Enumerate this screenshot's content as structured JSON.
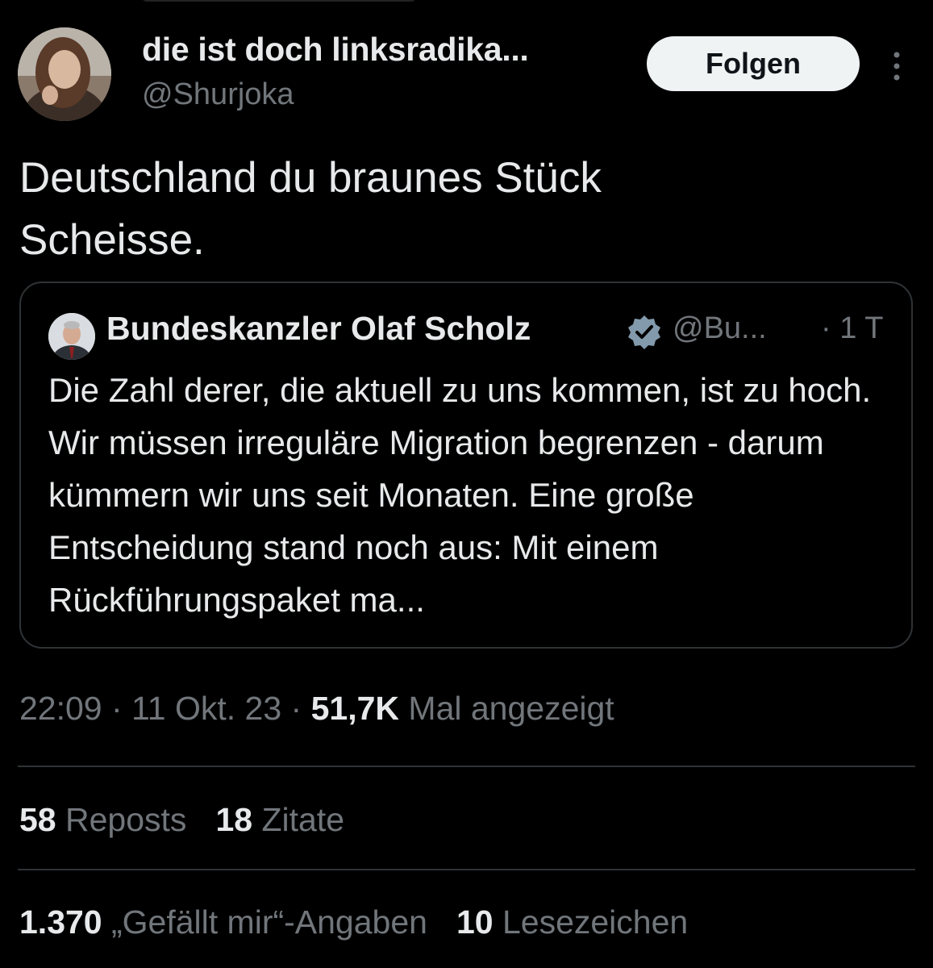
{
  "tweet": {
    "author": {
      "display_name": "die ist doch linksradika...",
      "handle": "@Shurjoka"
    },
    "follow_label": "Folgen",
    "text_line1": "Deutschland du braunes Stück",
    "text_line2": "Scheisse.",
    "quoted": {
      "display_name": "Bundeskanzler Olaf Scholz",
      "handle": "@Bu...",
      "time": "· 1 T",
      "text": "Die Zahl derer, die aktuell zu uns kommen, ist zu hoch. Wir müssen irreguläre Migration begrenzen - darum kümmern wir uns seit Monaten. Eine große Entscheidung stand noch aus: Mit einem Rückführungspaket ma..."
    },
    "timestamp": "22:09 · 11 Okt. 23 · ",
    "views_count": "51,7K",
    "views_label": "Mal angezeigt",
    "stats": {
      "reposts_count": "58",
      "reposts_label": "Reposts",
      "quotes_count": "18",
      "quotes_label": "Zitate",
      "likes_count": "1.370",
      "likes_label": "„Gefällt mir“-Angaben",
      "bookmarks_count": "10",
      "bookmarks_label": "Lesezeichen"
    }
  },
  "colors": {
    "background": "#000000",
    "text_primary": "#e7e9ea",
    "text_secondary": "#71767b",
    "border": "#2f3336",
    "verified_badge": "#829aab",
    "follow_button": "#eff3f4"
  }
}
